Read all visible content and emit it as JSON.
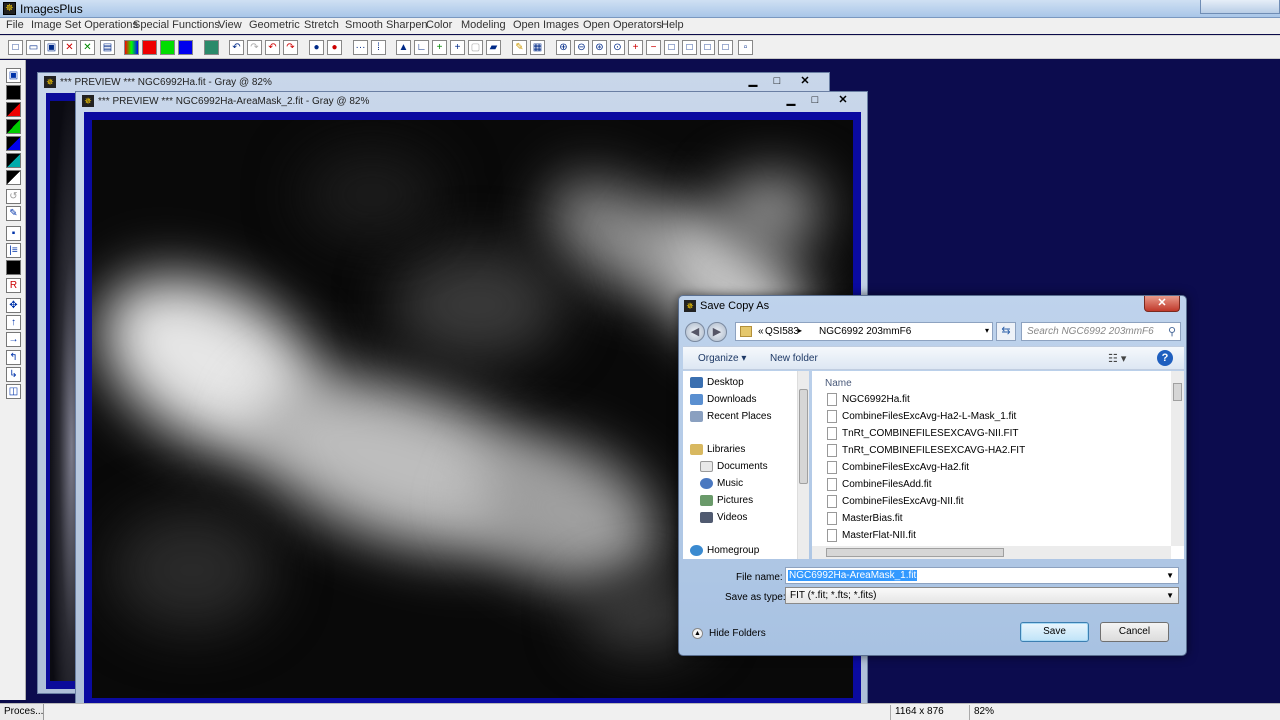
{
  "app": {
    "title": "ImagesPlus",
    "icon": "images-plus-icon"
  },
  "menu": [
    "File",
    "Image Set Operations",
    "Special Functions",
    "View",
    "Geometric",
    "Stretch",
    "Smooth Sharpen",
    "Color",
    "Modeling",
    "Open Images",
    "Open Operators",
    "Help"
  ],
  "windows": {
    "back": {
      "title": "*** PREVIEW *** NGC6992Ha.fit - Gray @ 82%",
      "min": "▁",
      "max": "□",
      "close": "✕"
    },
    "front": {
      "title": "*** PREVIEW *** NGC6992Ha-AreaMask_2.fit - Gray @ 82%",
      "min": "▁",
      "max": "□",
      "close": "✕"
    }
  },
  "status": {
    "task": "Proces...",
    "dimensions": "1164 x 876",
    "zoom": "82%"
  },
  "dialog": {
    "title": "Save Copy As",
    "close": "✕",
    "address": {
      "root": "«",
      "segment1": "QSI583",
      "separator": "▸",
      "segment2": "NGC6992 203mmF6",
      "dropdown": "▾"
    },
    "search_placeholder": "Search NGC6992 203mmF6",
    "toolbar": {
      "organize": "Organize ▾",
      "new_folder": "New folder",
      "view": "☷ ▾",
      "help": "?"
    },
    "nav": {
      "desktop": "Desktop",
      "downloads": "Downloads",
      "recent_places": "Recent Places",
      "libraries": "Libraries",
      "documents": "Documents",
      "music": "Music",
      "pictures": "Pictures",
      "videos": "Videos",
      "homegroup": "Homegroup"
    },
    "column_name": "Name",
    "files": [
      "NGC6992Ha.fit",
      "CombineFilesExcAvg-Ha2-L-Mask_1.fit",
      "TnRt_COMBINEFILESEXCAVG-NII.FIT",
      "TnRt_COMBINEFILESEXCAVG-HA2.FIT",
      "CombineFilesExcAvg-Ha2.fit",
      "CombineFilesAdd.fit",
      "CombineFilesExcAvg-NII.fit",
      "MasterBias.fit",
      "MasterFlat-NII.fit"
    ],
    "file_name_label": "File name:",
    "file_name_value": "NGC6992Ha-AreaMask_1.fit",
    "save_type_label": "Save as type:",
    "save_type_value": "FIT (*.fit; *.fts; *.fits)",
    "hide_folders": "Hide Folders",
    "save": "Save",
    "cancel": "Cancel"
  }
}
